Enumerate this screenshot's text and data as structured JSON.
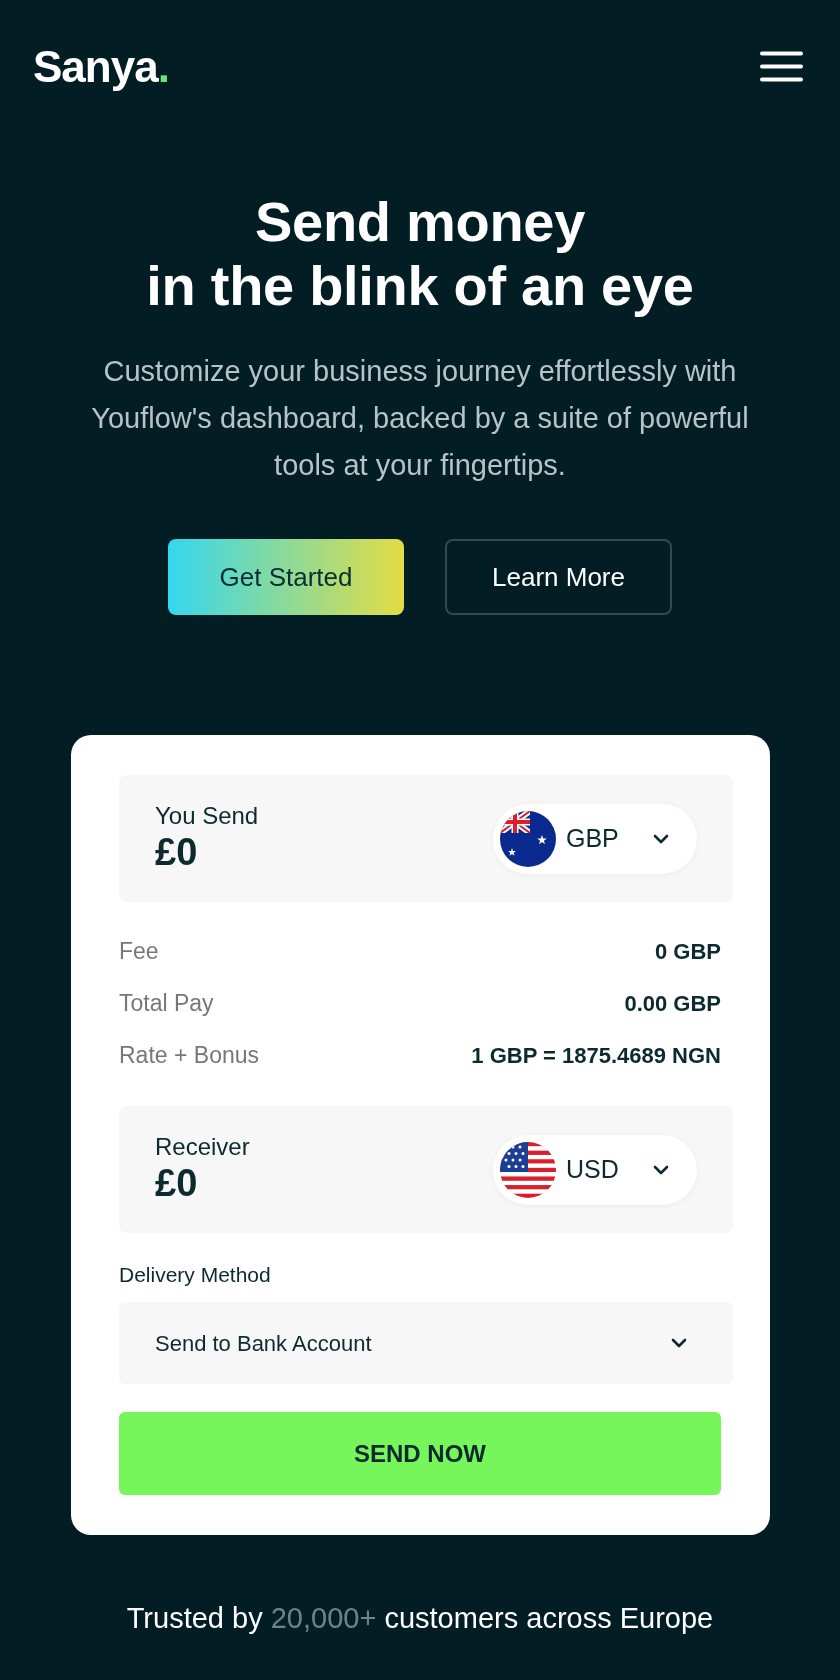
{
  "header": {
    "logo": {
      "text": "Sanya",
      "mark": "."
    }
  },
  "hero": {
    "title_lines": [
      "Send money",
      "in the blink of an eye"
    ],
    "subtitle": "Customize your business journey effortlessly with Youflow's dashboard, backed by a suite of powerful tools at your fingertips.",
    "buttons": [
      {
        "label": "Get Started",
        "kind": "primary"
      },
      {
        "label": "Learn More",
        "kind": "outline"
      }
    ]
  },
  "transfer": {
    "send": {
      "label": "You Send",
      "amount": "£0",
      "currency": "GBP"
    },
    "summary": [
      {
        "label": "Fee",
        "value": "0 GBP"
      },
      {
        "label": "Total Pay",
        "value": "0.00 GBP"
      },
      {
        "label": "Rate + Bonus",
        "value": "1 GBP = 1875.4689 NGN"
      }
    ],
    "receive": {
      "label": "Receiver",
      "amount": "£0",
      "currency": "USD"
    },
    "delivery": {
      "label": "Delivery Method",
      "value": "Send to Bank Account"
    },
    "submit": "SEND NOW"
  },
  "trust": {
    "parts": [
      {
        "text": "Trusted by",
        "highlight": false
      },
      {
        "text": "20,000+",
        "highlight": true
      },
      {
        "text": "customers across Europe",
        "highlight": false
      }
    ]
  }
}
